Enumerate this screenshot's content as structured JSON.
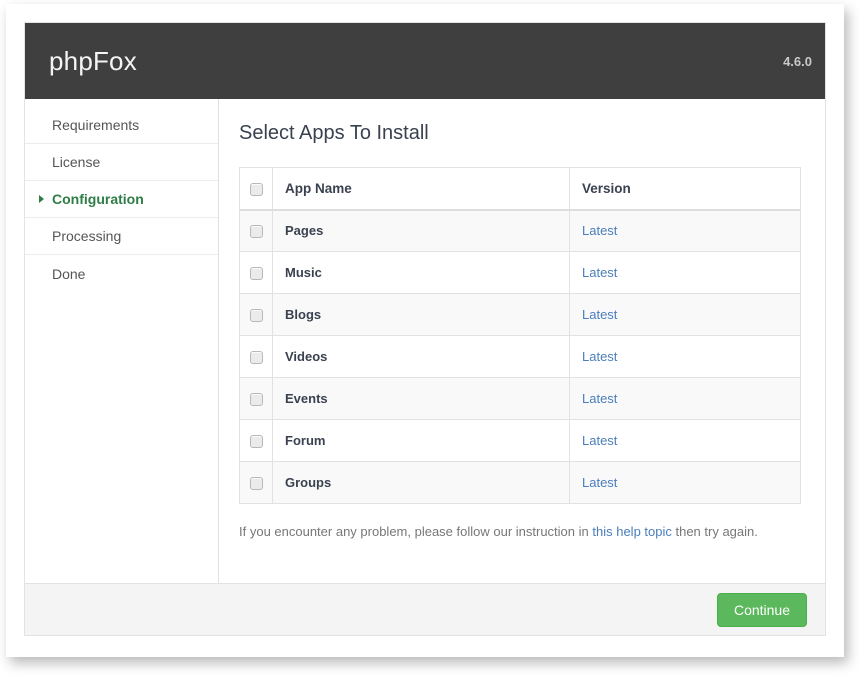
{
  "header": {
    "brand": "phpFox",
    "version": "4.6.0"
  },
  "sidebar": {
    "items": [
      {
        "label": "Requirements",
        "active": false
      },
      {
        "label": "License",
        "active": false
      },
      {
        "label": "Configuration",
        "active": true
      },
      {
        "label": "Processing",
        "active": false
      },
      {
        "label": "Done",
        "active": false
      }
    ]
  },
  "main": {
    "title": "Select Apps To Install",
    "table": {
      "columns": [
        "App Name",
        "Version"
      ],
      "rows": [
        {
          "name": "Pages",
          "version": "Latest"
        },
        {
          "name": "Music",
          "version": "Latest"
        },
        {
          "name": "Blogs",
          "version": "Latest"
        },
        {
          "name": "Videos",
          "version": "Latest"
        },
        {
          "name": "Events",
          "version": "Latest"
        },
        {
          "name": "Forum",
          "version": "Latest"
        },
        {
          "name": "Groups",
          "version": "Latest"
        }
      ]
    },
    "help_note": {
      "before": "If you encounter any problem, please follow our instruction in ",
      "link": "this help topic",
      "after": " then try again."
    }
  },
  "footer": {
    "continue_label": "Continue"
  },
  "colors": {
    "header_bg": "#3f3f3f",
    "accent_green": "#2e7d46",
    "button_green": "#5cb85c",
    "link_blue": "#4a7ebb",
    "text_dark": "#3a4250"
  }
}
